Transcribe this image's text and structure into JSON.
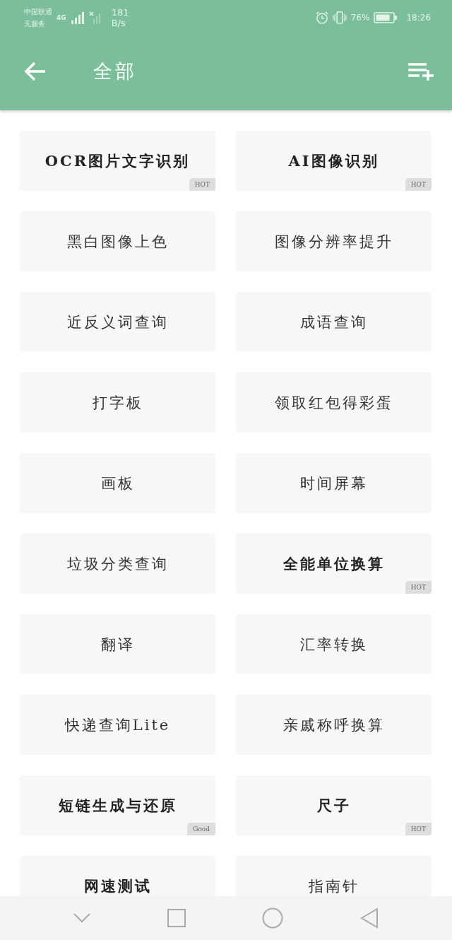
{
  "status_bar": {
    "carrier": "中国联通",
    "carrier_status": "无服务",
    "network": "4G",
    "speed": "181",
    "speed_unit": "B/s",
    "battery": "76%",
    "time": "18:26"
  },
  "app_bar": {
    "title": "全部"
  },
  "tools": [
    {
      "label": "OCR图片文字识别",
      "bold": true,
      "badge": "HOT"
    },
    {
      "label": "AI图像识别",
      "bold": true,
      "badge": "HOT"
    },
    {
      "label": "黑白图像上色",
      "bold": false
    },
    {
      "label": "图像分辨率提升",
      "bold": false
    },
    {
      "label": "近反义词查询",
      "bold": false
    },
    {
      "label": "成语查询",
      "bold": false
    },
    {
      "label": "打字板",
      "bold": false
    },
    {
      "label": "领取红包得彩蛋",
      "bold": false
    },
    {
      "label": "画板",
      "bold": false
    },
    {
      "label": "时间屏幕",
      "bold": false
    },
    {
      "label": "垃圾分类查询",
      "bold": false
    },
    {
      "label": "全能单位换算",
      "bold": true,
      "badge": "HOT"
    },
    {
      "label": "翻译",
      "bold": false
    },
    {
      "label": "汇率转换",
      "bold": false
    },
    {
      "label": "快递查询Lite",
      "bold": false
    },
    {
      "label": "亲戚称呼换算",
      "bold": false
    },
    {
      "label": "短链生成与还原",
      "bold": true,
      "badge": "Good"
    },
    {
      "label": "尺子",
      "bold": true,
      "badge": "HOT"
    },
    {
      "label": "网速测试",
      "bold": true
    },
    {
      "label": "指南针",
      "bold": false
    }
  ]
}
